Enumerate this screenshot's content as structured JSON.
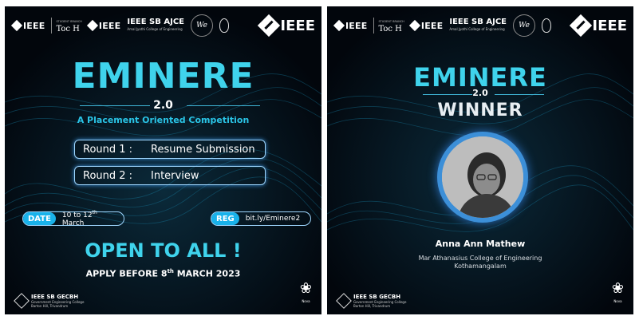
{
  "logos": {
    "ieee_small": "IEEE",
    "toch_branch": "STUDENT BRANCH",
    "toch": "Toc H",
    "ieee_mid": "IEEE",
    "ieee_mid_sub": "KERALA STUDENT BRANCH",
    "sb_ajce": "IEEE SB AJCE",
    "sb_ajce_sub": "Amal Jyothi College of Engineering",
    "circle_logo": "We",
    "ieee_big": "IEEE"
  },
  "poster1": {
    "title": "EMINERE",
    "version": "2.0",
    "tagline": "A Placement Oriented Competition",
    "rounds": [
      {
        "label": "Round  1 :",
        "value": "Resume Submission"
      },
      {
        "label": "Round  2 :",
        "value": "Interview"
      }
    ],
    "date_tag": "DATE",
    "date_value_a": "10 to 12",
    "date_value_sup": "th",
    "date_value_b": " March",
    "reg_tag": "REG",
    "reg_value": "bit.ly/Eminere2",
    "open": "OPEN TO ALL !",
    "apply_a": "APPLY BEFORE 8",
    "apply_sup": "th",
    "apply_b": " MARCH 2023",
    "footer_title": "IEEE SB GECBH",
    "footer_sub1": "Government Engineering College",
    "footer_sub2": "Barton Hill, Trivandrum",
    "signature": "Nova"
  },
  "poster2": {
    "title": "EMINERE",
    "version": "2.0",
    "winner": "WINNER",
    "name": "Anna Ann Mathew",
    "college1": "Mar Athanasius College of Engineering",
    "college2": "Kothamangalam",
    "footer_title": "IEEE SB GECBH",
    "footer_sub1": "Government Engineering College",
    "footer_sub2": "Barton Hill, Trivandrum",
    "signature": "Nova"
  },
  "colors": {
    "background": "#02060c",
    "accent": "#3fd3ec",
    "ring": "#3c8fd8"
  }
}
